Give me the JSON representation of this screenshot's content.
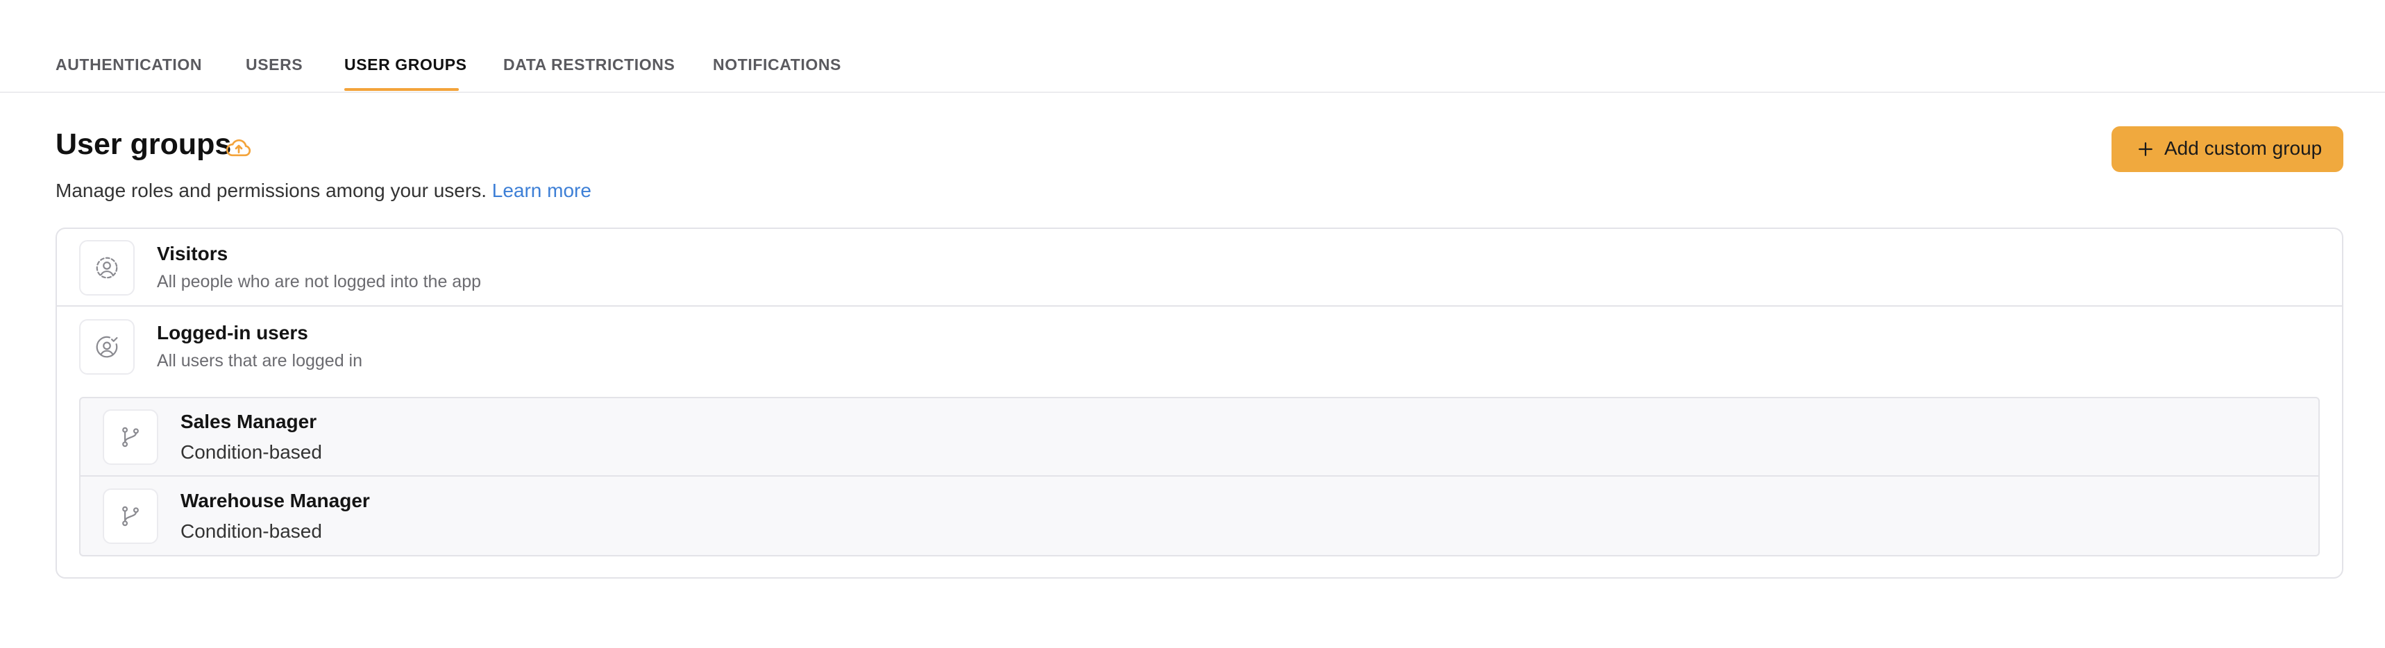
{
  "tabs": [
    {
      "label": "AUTHENTICATION"
    },
    {
      "label": "USERS"
    },
    {
      "label": "USER GROUPS"
    },
    {
      "label": "DATA RESTRICTIONS"
    },
    {
      "label": "NOTIFICATIONS"
    }
  ],
  "active_tab": "USER GROUPS",
  "header": {
    "title": "User groups",
    "title_icon": "cloud-upload-icon",
    "subtitle": "Manage roles and permissions among your users.",
    "learn_more": "Learn more",
    "add_button": "Add custom group",
    "add_button_icon": "plus-icon"
  },
  "groups": [
    {
      "title": "Visitors",
      "description": "All people who are not logged into the app",
      "icon": "user-circle-dashed-icon"
    },
    {
      "title": "Logged-in users",
      "description": "All users that are logged in",
      "icon": "user-circle-check-icon"
    }
  ],
  "subgroups": [
    {
      "title": "Sales Manager",
      "description": "Condition-based",
      "icon": "git-branch-icon"
    },
    {
      "title": "Warehouse Manager",
      "description": "Condition-based",
      "icon": "git-branch-icon"
    }
  ],
  "colors": {
    "accent": "#f0a93e",
    "tab_underline": "#f3a33a",
    "link": "#3d7fd6"
  }
}
